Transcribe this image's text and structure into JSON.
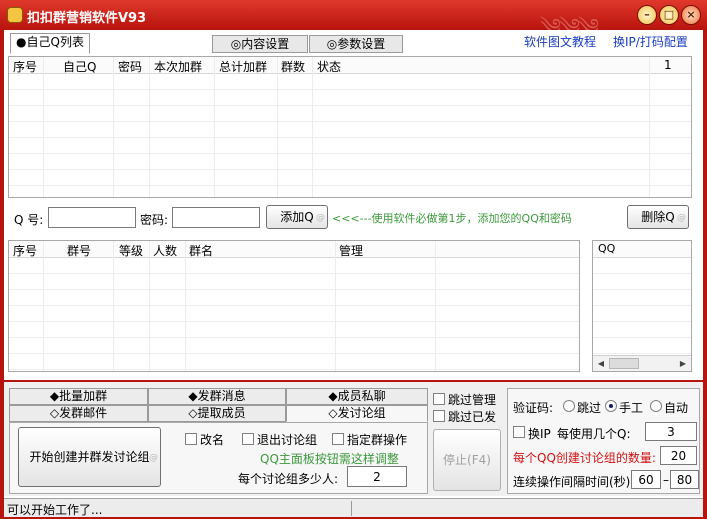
{
  "window": {
    "title": "扣扣群营销软件V93",
    "min": "–",
    "max": "□",
    "close": "×"
  },
  "tabs": [
    "●自己Q列表",
    "◎内容设置",
    "◎参数设置"
  ],
  "links": {
    "tutorial": "软件图文教程",
    "ip_config": "换IP/打码配置"
  },
  "q_table": {
    "columns": [
      "序号",
      "自己Q",
      "密码",
      "本次加群",
      "总计加群",
      "群数",
      "状态"
    ],
    "counter": "1"
  },
  "add_form": {
    "q_label": "Q 号:",
    "q_value": "",
    "pwd_label": "密码:",
    "pwd_value": "",
    "add_button": "添加Q",
    "hint": "<<<---使用软件必做第1步，添加您的QQ和密码",
    "delete_button": "删除Q"
  },
  "group_table": {
    "columns": [
      "序号",
      "群号",
      "等级",
      "人数",
      "群名",
      "管理"
    ]
  },
  "qq_table": {
    "columns": [
      "QQ"
    ]
  },
  "func_tabs": {
    "row1": [
      "◆批量加群",
      "◆发群消息",
      "◆成员私聊"
    ],
    "row2": [
      "◇发群邮件",
      "◇提取成员",
      "◇发讨论组"
    ]
  },
  "side_checks": {
    "skip_admin": "跳过管理",
    "skip_sent": "跳过已发"
  },
  "discuss": {
    "start_button": "开始创建并群发讨论组",
    "rename": "改名",
    "quit": "退出讨论组",
    "specify": "指定群操作",
    "hint": "QQ主面板按钮需这样调整",
    "per_group_label": "每个讨论组多少人:",
    "per_group_value": "2",
    "stop_button": "停止(F4)"
  },
  "settings": {
    "captcha_label": "验证码:",
    "captcha_options": [
      "跳过",
      "手工",
      "自动"
    ],
    "captcha_selected": "手工",
    "change_ip": "换IP",
    "use_count_label": "每使用几个Q:",
    "use_count_value": "3",
    "create_count_label": "每个QQ创建讨论组的数量:",
    "create_count_value": "20",
    "interval_label": "连续操作间隔时间(秒)",
    "interval_min": "60",
    "interval_dash": "–",
    "interval_max": "80"
  },
  "status": {
    "text": "可以开始工作了..."
  }
}
